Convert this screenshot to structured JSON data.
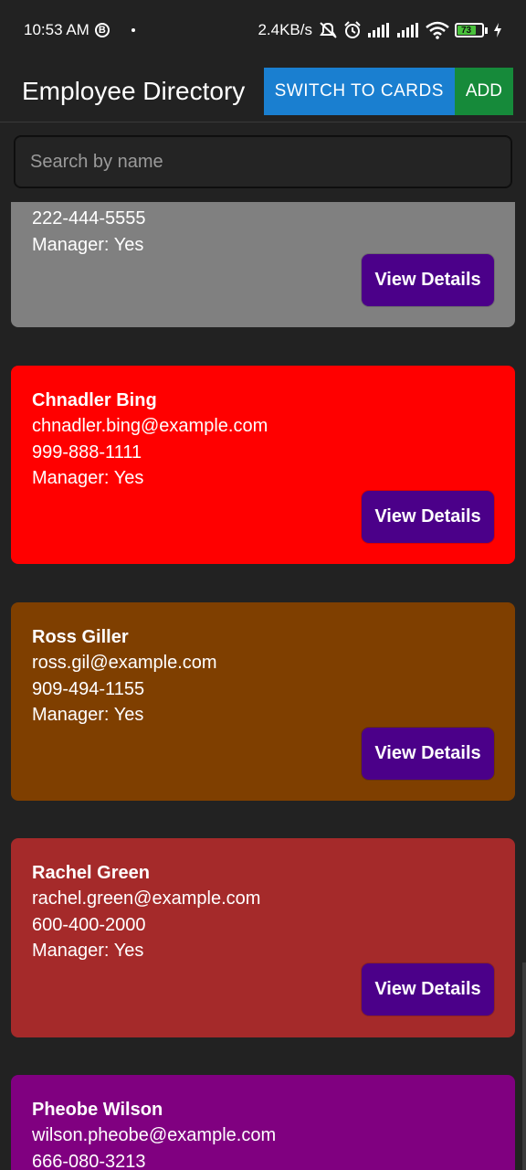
{
  "status": {
    "time": "10:53 AM",
    "b_badge": "B",
    "net_speed": "2.4KB/s",
    "battery": "73",
    "icons": [
      "mute-icon",
      "alarm-icon",
      "signal-icon",
      "signal-icon",
      "wifi-icon",
      "battery-icon",
      "charging-icon"
    ]
  },
  "appbar": {
    "title": "Employee Directory",
    "switch_label": "SWITCH TO CARDS",
    "add_label": "ADD",
    "switch_color": "#1a7fd0",
    "add_color": "#168a3a"
  },
  "search": {
    "placeholder": "Search by name",
    "value": ""
  },
  "view_details_label": "View Details",
  "employees": [
    {
      "name": "",
      "email": "",
      "phone": "222-444-5555",
      "manager": "Manager: Yes",
      "color": "#808080"
    },
    {
      "name": "Chnadler Bing",
      "email": "chnadler.bing@example.com",
      "phone": "999-888-1111",
      "manager": "Manager: Yes",
      "color": "#ff0000"
    },
    {
      "name": "Ross Giller",
      "email": "ross.gil@example.com",
      "phone": "909-494-1155",
      "manager": "Manager: Yes",
      "color": "#7f3f00"
    },
    {
      "name": "Rachel Green",
      "email": "rachel.green@example.com",
      "phone": "600-400-2000",
      "manager": "Manager: Yes",
      "color": "#a52a2a"
    },
    {
      "name": "Pheobe Wilson",
      "email": "wilson.pheobe@example.com",
      "phone": "666-080-3213",
      "manager": "",
      "color": "#800080"
    }
  ]
}
